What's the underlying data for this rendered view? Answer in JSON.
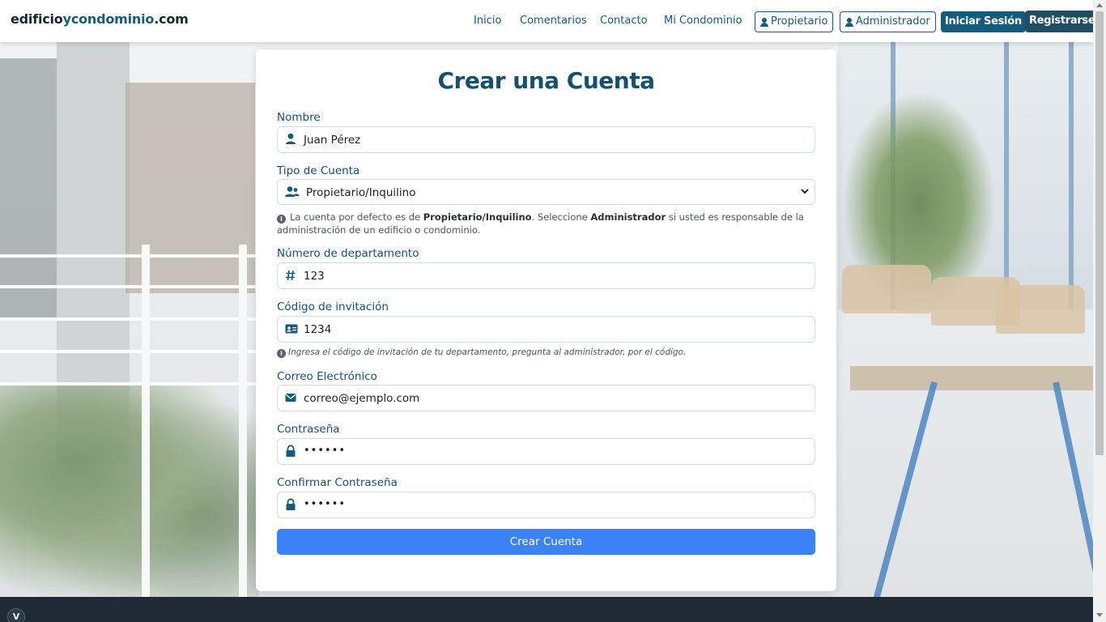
{
  "brand": {
    "part1": "edificio",
    "part2": "ycondominio",
    "part3": ".com"
  },
  "nav": {
    "links": [
      "Inicio",
      "Comentarios",
      "Contacto",
      "Mi Condominio"
    ],
    "propietario": "Propietario",
    "administrador": "Administrador",
    "login": "Iniciar Sesión",
    "register": "Registrarse"
  },
  "form": {
    "title": "Crear una Cuenta",
    "nombre": {
      "label": "Nombre",
      "value": "Juan Pérez"
    },
    "tipo": {
      "label": "Tipo de Cuenta",
      "selected": "Propietario/Inquilino",
      "help_pre": "La cuenta por defecto es de ",
      "help_b1": "Propietario/Inquilino",
      "help_mid": ". Seleccione ",
      "help_b2": "Administrador",
      "help_post": " si usted es responsable de la administración de un edificio o condominio."
    },
    "departamento": {
      "label": "Número de departamento",
      "value": "123"
    },
    "invitacion": {
      "label": "Código de invitación",
      "value": "1234",
      "help": "Ingresa el código de invitación de tu departamento, pregunta al administrador, por el código."
    },
    "correo": {
      "label": "Correo Electrónico",
      "value": "correo@ejemplo.com"
    },
    "password": {
      "label": "Contraseña",
      "value": "••••••"
    },
    "confirm": {
      "label": "Confirmar Contraseña",
      "value": "••••••"
    },
    "submit": "Crear Cuenta"
  },
  "footer": {
    "badge": "V"
  },
  "colors": {
    "primary": "#155b7c",
    "submit": "#3b82f6",
    "footer": "#1f2a35"
  },
  "icons": [
    "user-icon",
    "users-icon",
    "hashtag-icon",
    "id-card-icon",
    "envelope-icon",
    "lock-icon",
    "info-icon",
    "chevron-down-icon"
  ]
}
